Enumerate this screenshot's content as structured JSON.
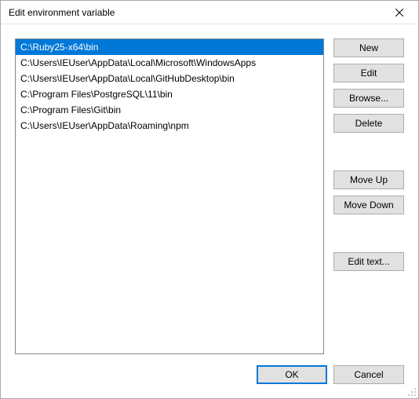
{
  "window": {
    "title": "Edit environment variable"
  },
  "list": {
    "items": [
      {
        "path": "C:\\Ruby25-x64\\bin",
        "selected": true
      },
      {
        "path": "C:\\Users\\IEUser\\AppData\\Local\\Microsoft\\WindowsApps",
        "selected": false
      },
      {
        "path": "C:\\Users\\IEUser\\AppData\\Local\\GitHubDesktop\\bin",
        "selected": false
      },
      {
        "path": "C:\\Program Files\\PostgreSQL\\11\\bin",
        "selected": false
      },
      {
        "path": "C:\\Program Files\\Git\\bin",
        "selected": false
      },
      {
        "path": "C:\\Users\\IEUser\\AppData\\Roaming\\npm",
        "selected": false
      }
    ]
  },
  "buttons": {
    "new": "New",
    "edit": "Edit",
    "browse": "Browse...",
    "delete": "Delete",
    "move_up": "Move Up",
    "move_down": "Move Down",
    "edit_text": "Edit text...",
    "ok": "OK",
    "cancel": "Cancel"
  }
}
